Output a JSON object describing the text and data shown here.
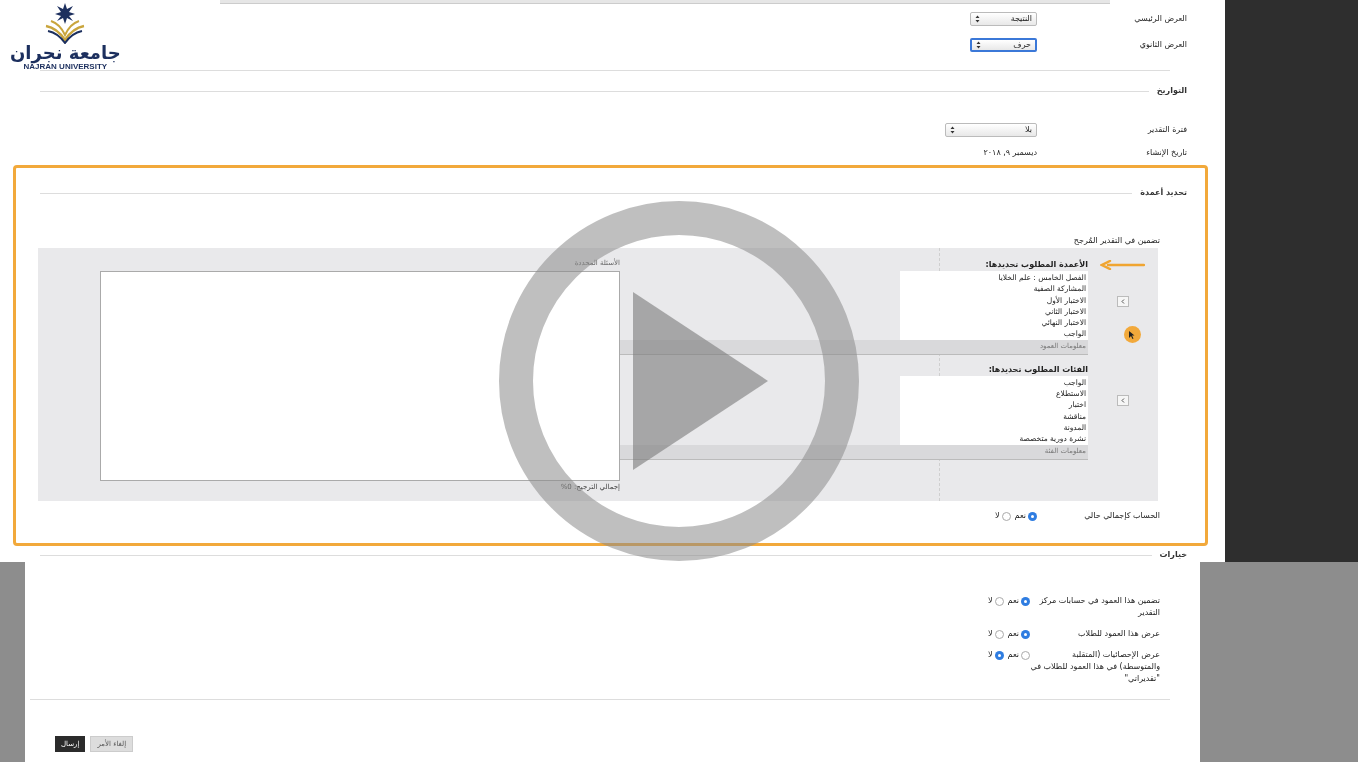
{
  "logo": {
    "arabic": "جامعة نجران",
    "english": "NAJRAN UNIVERSITY"
  },
  "display": [
    {
      "label": "العرض الرئيسي",
      "value": "النتيجة",
      "focused": false
    },
    {
      "label": "العرض الثانوي",
      "value": "حرف",
      "focused": true
    }
  ],
  "dates": {
    "heading": "التواريخ",
    "fields": [
      {
        "kind": "select",
        "label": "فترة التقدير",
        "value": "بلا"
      },
      {
        "kind": "text",
        "label": "تاريخ الإنشاء",
        "value": "ديسمبر ٩, ٢٠١٨"
      }
    ]
  },
  "column_selection": {
    "heading": "تحديد أعمدة",
    "highlighted": true,
    "include_label": "تضمين في التقدير المُرجح",
    "source_lists": [
      {
        "heading": "الأعمدة المطلوب تحديدها:",
        "pointer": true,
        "items": [
          "الفصل الخامس : علم الخلايا",
          "المشاركة الصفية",
          "الاختبار الأول",
          "الاختبار الثاني",
          "الاختبار النهائي",
          "الواجب"
        ],
        "info": "معلومات العمود"
      },
      {
        "heading": "الفئات المطلوب تحديدها:",
        "pointer": false,
        "items": [
          "الواجب",
          "الاستطلاع",
          "اختبار",
          "مناقشة",
          "المدونة",
          "نشرة دورية متخصصة"
        ],
        "info": "معلومات الفئة"
      }
    ],
    "selected_heading": "الأسئلة المحددة",
    "total": "إجمالي الترجيح: 0%",
    "running_total": {
      "label": "الحساب كإجمالي حالي",
      "options": [
        {
          "label": "نعم",
          "selected": true
        },
        {
          "label": "لا",
          "selected": false
        }
      ]
    }
  },
  "options": {
    "heading": "خيارات",
    "rows": [
      {
        "label": "تضمين هذا العمود في حسابات مركز التقدير",
        "options": [
          {
            "label": "نعم",
            "selected": true
          },
          {
            "label": "لا",
            "selected": false
          }
        ]
      },
      {
        "label": "عرض هذا العمود للطلاب",
        "options": [
          {
            "label": "نعم",
            "selected": true
          },
          {
            "label": "لا",
            "selected": false
          }
        ]
      },
      {
        "label": "عرض الإحصائيات (المتقلبة والمتوسطة) في هذا العمود للطلاب في \"تقديراتي\"",
        "options": [
          {
            "label": "نعم",
            "selected": false
          },
          {
            "label": "لا",
            "selected": true
          }
        ]
      }
    ]
  },
  "buttons": [
    {
      "label": "إلغاء الأمر",
      "kind": "secondary"
    },
    {
      "label": "إرسال",
      "kind": "primary"
    }
  ],
  "video": {
    "paused": true
  }
}
